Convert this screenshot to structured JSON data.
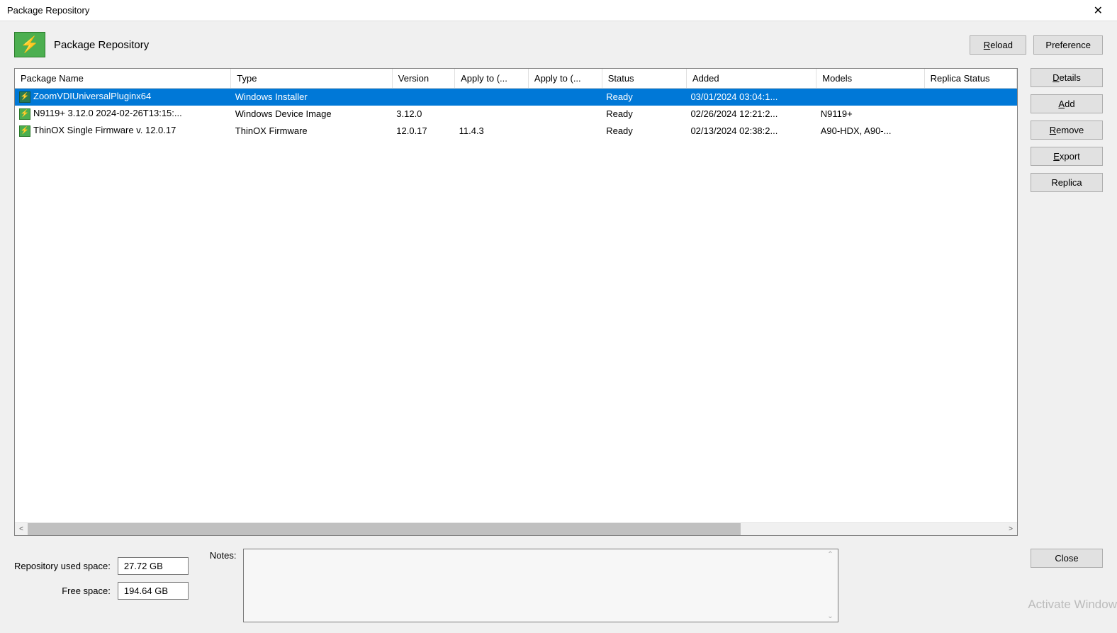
{
  "window": {
    "title": "Package Repository"
  },
  "header": {
    "title": "Package Repository",
    "reload": "Reload",
    "preference": "Preference"
  },
  "table": {
    "columns": {
      "name": "Package Name",
      "type": "Type",
      "version": "Version",
      "apply1": "Apply to (...",
      "apply2": "Apply to (...",
      "status": "Status",
      "added": "Added",
      "models": "Models",
      "replica": "Replica Status"
    },
    "rows": [
      {
        "name": "ZoomVDIUniversalPluginx64",
        "type": "Windows Installer",
        "version": "",
        "apply1": "",
        "apply2": "",
        "status": "Ready",
        "added": "03/01/2024 03:04:1...",
        "models": "",
        "replica": "",
        "selected": true
      },
      {
        "name": "N9119+ 3.12.0 2024-02-26T13:15:...",
        "type": "Windows Device Image",
        "version": "3.12.0",
        "apply1": "",
        "apply2": "",
        "status": "Ready",
        "added": "02/26/2024 12:21:2...",
        "models": "N9119+",
        "replica": ""
      },
      {
        "name": "ThinOX Single Firmware v. 12.0.17",
        "type": "ThinOX Firmware",
        "version": "12.0.17",
        "apply1": "11.4.3",
        "apply2": "",
        "status": "Ready",
        "added": "02/13/2024 02:38:2...",
        "models": "A90-HDX, A90-...",
        "replica": ""
      }
    ]
  },
  "side": {
    "details": "Details",
    "add": "Add",
    "remove": "Remove",
    "export": "Export",
    "replica": "Replica"
  },
  "footer": {
    "used_label": "Repository used space:",
    "used_value": "27.72 GB",
    "free_label": "Free space:",
    "free_value": "194.64 GB",
    "notes_label": "Notes:",
    "close": "Close"
  },
  "watermark": "Activate Window"
}
